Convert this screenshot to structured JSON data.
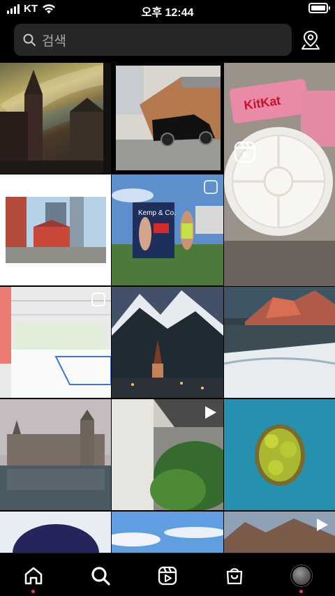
{
  "status": {
    "carrier": "KT",
    "time": "오후 12:44"
  },
  "search": {
    "placeholder": "검색"
  },
  "icons": {
    "search": "search-icon",
    "location": "map-pin-icon",
    "home": "home-icon",
    "explore": "explore-search-icon",
    "reels": "reels-icon",
    "shop": "shop-icon",
    "profile": "profile-avatar"
  },
  "tiles": [
    {
      "name": "tile-church-street",
      "badge": "none"
    },
    {
      "name": "tile-car-building",
      "badge": "none"
    },
    {
      "name": "tile-kitkat-plate",
      "badge": "reel"
    },
    {
      "name": "tile-architecture-render",
      "badge": "none"
    },
    {
      "name": "tile-sold-sign-couple",
      "badge": "carousel"
    },
    {
      "name": "tile-indoor-court",
      "badge": "carousel"
    },
    {
      "name": "tile-alpine-village",
      "badge": "none"
    },
    {
      "name": "tile-beach-sunset-mountains",
      "badge": "none"
    },
    {
      "name": "tile-castle-lake",
      "badge": "none"
    },
    {
      "name": "tile-concrete-corridor-garden",
      "badge": "video"
    },
    {
      "name": "tile-aerial-island",
      "badge": "none"
    },
    {
      "name": "tile-person-portrait",
      "badge": "none"
    },
    {
      "name": "tile-sky-clouds",
      "badge": "none"
    },
    {
      "name": "tile-mountain-dusk",
      "badge": "video"
    }
  ],
  "tabs": [
    {
      "name": "tab-home",
      "dot": true
    },
    {
      "name": "tab-explore",
      "dot": false
    },
    {
      "name": "tab-reels",
      "dot": false
    },
    {
      "name": "tab-shop",
      "dot": false
    },
    {
      "name": "tab-profile",
      "dot": true
    }
  ],
  "colors": {
    "background": "#000000",
    "search_bg": "#262626",
    "placeholder": "#a8a8a8",
    "notification_dot": "#ff3040"
  }
}
